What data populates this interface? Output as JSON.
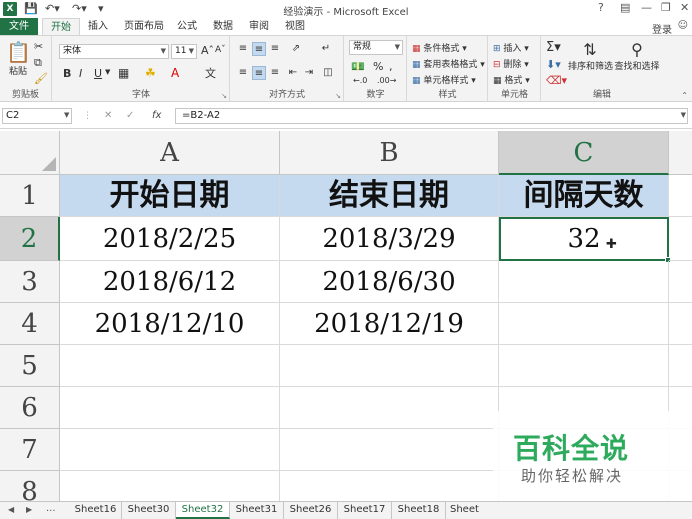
{
  "titlebar": {
    "window_title": "经验演示 - Microsoft Excel",
    "help": "?",
    "minimize": "—",
    "restore": "❐",
    "close": "✕",
    "app_icon": "X"
  },
  "ribbon_tabs": {
    "file": "文件",
    "items": [
      "开始",
      "插入",
      "页面布局",
      "公式",
      "数据",
      "审阅",
      "视图"
    ],
    "login": "登录"
  },
  "ribbon": {
    "clipboard": {
      "label": "剪贴板",
      "paste": "粘贴"
    },
    "font": {
      "label": "字体",
      "font_name": "宋体",
      "font_size": "11",
      "bold": "B",
      "italic": "I",
      "underline": "U"
    },
    "alignment": {
      "label": "对齐方式"
    },
    "number": {
      "label": "数字",
      "format": "常规",
      "percent": "%"
    },
    "styles": {
      "label": "样式",
      "conditional": "条件格式",
      "table": "套用表格格式",
      "cell_styles": "单元格样式"
    },
    "cells": {
      "label": "单元格",
      "insert": "插入",
      "delete": "删除",
      "format": "格式"
    },
    "editing": {
      "label": "编辑",
      "sort_filter": "排序和筛选",
      "find_select": "查找和选择"
    }
  },
  "formula_bar": {
    "name_box": "C2",
    "formula": "=B2-A2"
  },
  "grid": {
    "columns": [
      "A",
      "B",
      "C"
    ],
    "rows": [
      "1",
      "2",
      "3",
      "4",
      "5",
      "6",
      "7",
      "8"
    ],
    "header_row": [
      "开始日期",
      "结束日期",
      "间隔天数"
    ],
    "data": [
      [
        "2018/2/25",
        "2018/3/29",
        "32"
      ],
      [
        "2018/6/12",
        "2018/6/30",
        ""
      ],
      [
        "2018/12/10",
        "2018/12/19",
        ""
      ]
    ],
    "active_cell": "C2"
  },
  "watermark": {
    "title": "百科全说",
    "subtitle": "助你轻松解决"
  },
  "sheets": {
    "ellipsis": "...",
    "tabs": [
      "Sheet16",
      "Sheet30",
      "Sheet32",
      "Sheet31",
      "Sheet26",
      "Sheet17",
      "Sheet18",
      "Sheet"
    ],
    "active": "Sheet32"
  },
  "colors": {
    "accent": "#217346",
    "header_fill": "#c5d9ef",
    "watermark_green": "#2eaa5c"
  }
}
